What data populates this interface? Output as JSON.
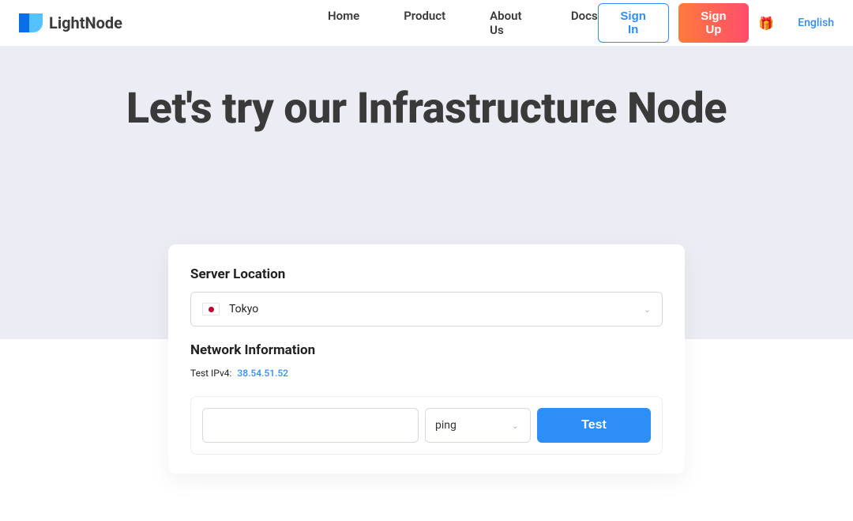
{
  "header": {
    "brand": "LightNode",
    "nav": {
      "home": "Home",
      "product": "Product",
      "about": "About Us",
      "docs": "Docs"
    },
    "signin": "Sign In",
    "signup": "Sign Up",
    "language": "English"
  },
  "hero": {
    "title": "Let's try our Infrastructure Node"
  },
  "card": {
    "location_label": "Server Location",
    "location_value": "Tokyo",
    "network_label": "Network Information",
    "ipv4_label": "Test IPv4:",
    "ipv4_value": "38.54.51.52",
    "test_method": "ping",
    "test_button": "Test",
    "host_placeholder": ""
  }
}
